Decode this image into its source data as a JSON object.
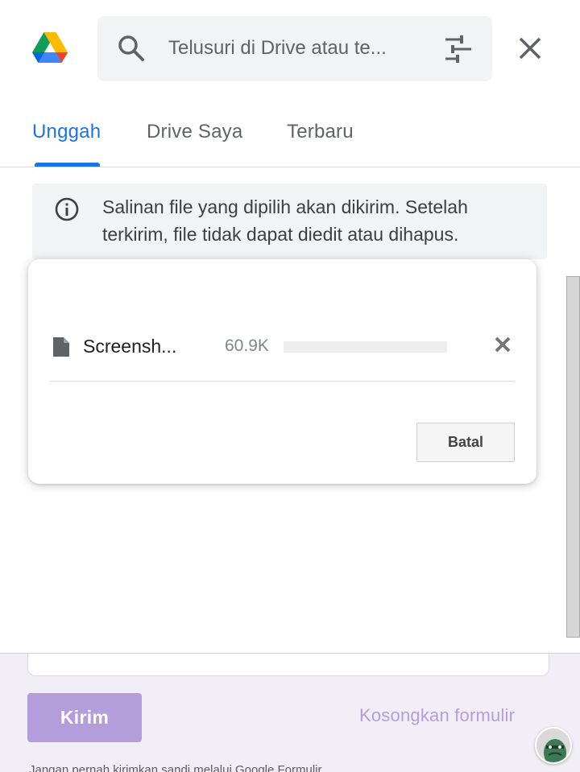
{
  "search": {
    "placeholder": "Telusuri di Drive atau te..."
  },
  "tabs": [
    {
      "label": "Unggah",
      "active": true
    },
    {
      "label": "Drive Saya",
      "active": false
    },
    {
      "label": "Terbaru",
      "active": false
    }
  ],
  "info": {
    "text": "Salinan file yang dipilih akan dikirim. Setelah terkirim, file tidak dapat diedit atau dihapus."
  },
  "upload": {
    "file_name": "Screensh...",
    "file_size": "60.9K",
    "progress": 0,
    "cancel_label": "Batal"
  },
  "form": {
    "submit_label": "Kirim",
    "clear_label": "Kosongkan formulir",
    "footer_text": "Jangan pernah kirimkan sandi melalui Google Formulir."
  },
  "colors": {
    "accent": "#1a73e8",
    "form_primary": "#b39ddb",
    "info_bg": "#f1f3f4"
  },
  "icons": [
    "google-drive-logo",
    "search-icon",
    "tune-icon",
    "close-icon",
    "info-icon",
    "file-icon",
    "cancel-x-icon"
  ]
}
